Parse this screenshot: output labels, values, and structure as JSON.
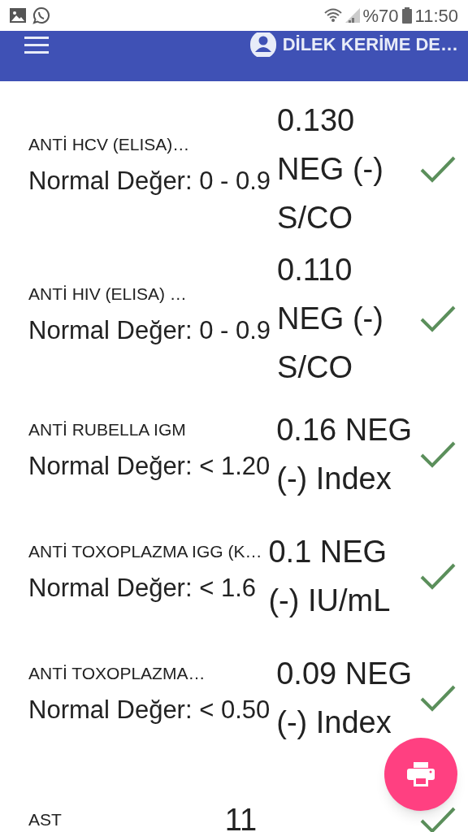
{
  "status_bar": {
    "battery_percent": "%70",
    "time": "11:50"
  },
  "app_bar": {
    "user_name": "DİLEK KERİME DE…"
  },
  "results": [
    {
      "name": "ANTİ HCV (ELISA)…",
      "normal": "Normal Değer: 0 - 0.9",
      "value": "0.130 NEG (-) S/CO",
      "ok": true
    },
    {
      "name": "ANTİ HIV (ELISA) …",
      "normal": "Normal Değer: 0 - 0.9",
      "value": "0.110 NEG (-) S/CO",
      "ok": true
    },
    {
      "name": "ANTİ RUBELLA IGM",
      "normal": "Normal Değer: < 1.20",
      "value": "0.16 NEG (-) Index",
      "ok": true
    },
    {
      "name": "ANTİ TOXOPLAZMA IGG (K…",
      "normal": "Normal Değer: < 1.6",
      "value": "0.1 NEG (-) IU/mL",
      "ok": true
    },
    {
      "name": "ANTİ TOXOPLAZMA…",
      "normal": "Normal Değer: < 0.50",
      "value": "0.09 NEG (-) Index",
      "ok": true
    },
    {
      "name": "AST",
      "value": "11",
      "ok": true
    }
  ]
}
